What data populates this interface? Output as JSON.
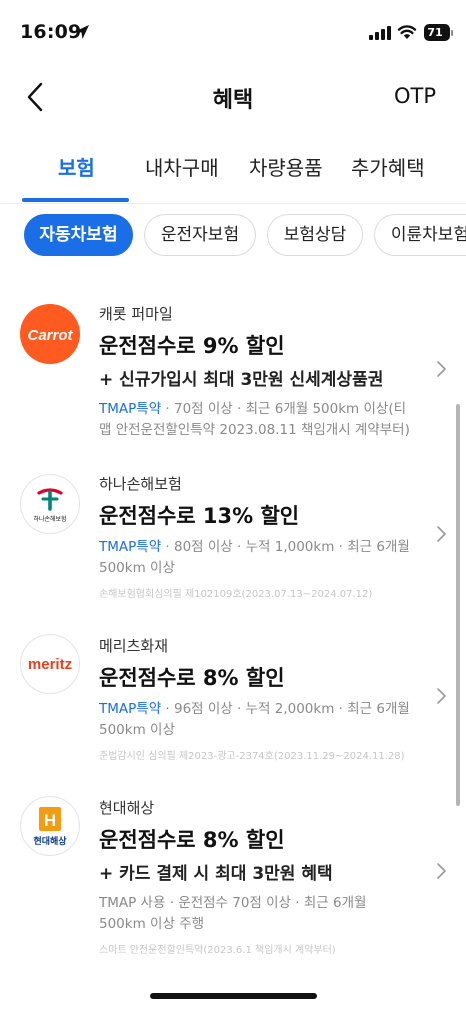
{
  "status_bar": {
    "time": "16:09",
    "battery": "71"
  },
  "nav": {
    "title": "혜택",
    "otp": "OTP"
  },
  "main_tabs": [
    {
      "label": "보험",
      "active": true
    },
    {
      "label": "내차구매",
      "active": false
    },
    {
      "label": "차량용품",
      "active": false
    },
    {
      "label": "추가혜택",
      "active": false
    }
  ],
  "chips": [
    {
      "label": "자동차보험",
      "active": true
    },
    {
      "label": "운전자보험",
      "active": false
    },
    {
      "label": "보험상담",
      "active": false
    },
    {
      "label": "이륜차보험",
      "active": false
    }
  ],
  "offers": [
    {
      "company": "캐롯 퍼마일",
      "logo_text": "Carrot",
      "headline": "운전점수로 9% 할인",
      "subline": "+ 신규가입시 최대 3만원 신세계상품권",
      "detail_highlight": "TMAP특약",
      "detail_rest": " · 70점 이상 · 최근 6개월 500km 이상(티맵 안전운전할인특약 2023.08.11 책임개시 계약부터)",
      "fine_print": ""
    },
    {
      "company": "하나손해보험",
      "logo_text": "하나손해보험",
      "headline": "운전점수로 13% 할인",
      "subline": "",
      "detail_highlight": "TMAP특약",
      "detail_rest": " · 80점 이상 · 누적 1,000km · 최근 6개월 500km 이상",
      "fine_print": "손해보험협회심의필 제102109호(2023.07.13~2024.07.12)"
    },
    {
      "company": "메리츠화재",
      "logo_text": "meritz",
      "headline": "운전점수로 8% 할인",
      "subline": "",
      "detail_highlight": "TMAP특약",
      "detail_rest": " · 96점 이상 · 누적 2,000km · 최근 6개월 500km 이상",
      "fine_print": "준법감시인 심의필 제2023-광고-2374호(2023.11.29~2024.11.28)"
    },
    {
      "company": "현대해상",
      "logo_text": "현대해상",
      "logo_letter": "H",
      "headline": "운전점수로 8% 할인",
      "subline": "+ 카드 결제 시 최대 3만원 혜택",
      "detail_highlight": "",
      "detail_rest": "TMAP 사용 · 운전점수 70점 이상 · 최근 6개월 500km 이상 주행",
      "fine_print": "스마트 안전운전할인특약(2023.6.1 책임개시 계약부터)"
    }
  ],
  "colors": {
    "accent": "#1a6ee6",
    "carrot": "#ff5a1f",
    "hana_green": "#00857a",
    "hana_red": "#e4002b",
    "meritz_red": "#e8401c",
    "hyundai_orange": "#f39c12",
    "hyundai_blue": "#0a3a8c"
  }
}
